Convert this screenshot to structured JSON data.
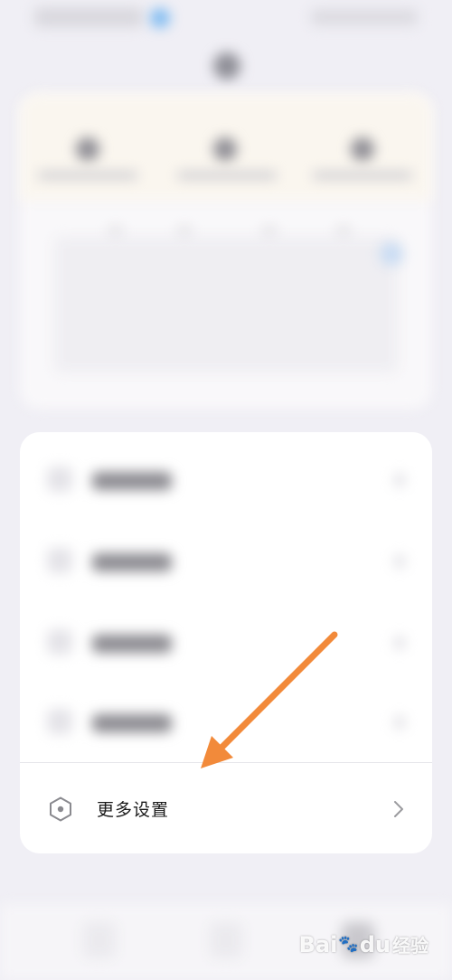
{
  "more_settings": {
    "label": "更多设置",
    "icon": "hexagon-settings-icon",
    "chevron_icon": "chevron-right-icon"
  },
  "annotation": {
    "arrow_color": "#f28a3a"
  },
  "watermark": {
    "text": "Bai",
    "paw": "🐾",
    "suffix": "du",
    "cn": "经验"
  },
  "colors": {
    "background": "#f0eff5",
    "card": "#ffffff",
    "text": "#1a1a1a",
    "icon_stroke": "#8a8a8f",
    "chevron": "#9b9b9f"
  }
}
